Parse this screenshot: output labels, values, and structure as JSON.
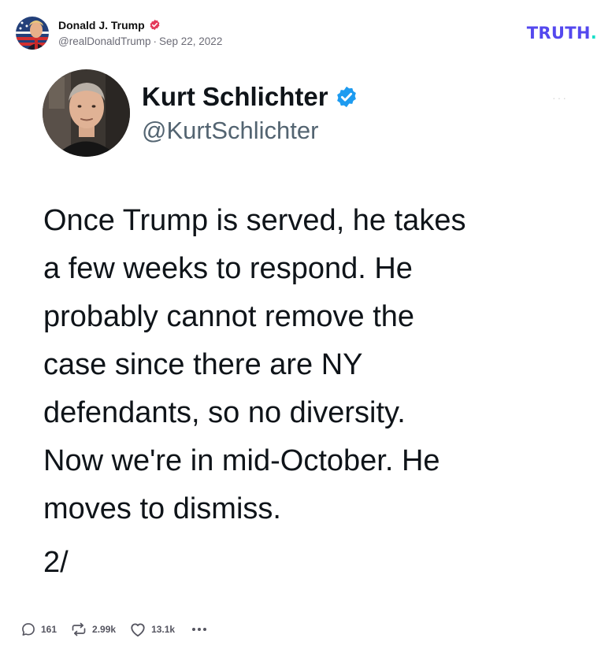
{
  "post": {
    "author_name": "Donald J. Trump",
    "handle": "@realDonaldTrump",
    "separator": "·",
    "date": "Sep 22, 2022"
  },
  "brand": {
    "logo_text": "TRUTH",
    "logo_dot": ".",
    "primary_color": "#5448ee",
    "accent_color": "#19e0c8"
  },
  "embedded_tweet": {
    "name": "Kurt Schlichter",
    "handle": "@KurtSchlichter",
    "body": "Once Trump is served, he takes\na few weeks to respond. He\nprobably cannot remove the\ncase since there are NY\ndefendants, so no diversity.\nNow we're in mid-October. He\nmoves to dismiss.",
    "thread_marker": "2/",
    "verified_color": "#1d9bf0"
  },
  "actions": {
    "replies": "161",
    "retruths": "2.99k",
    "likes": "13.1k"
  },
  "icons": {
    "author_badge": "verified-badge-icon",
    "tweet_badge": "verified-badge-icon",
    "reply": "speech-bubble-icon",
    "retruth": "repost-arrows-icon",
    "like": "heart-icon",
    "more": "ellipsis-icon"
  }
}
